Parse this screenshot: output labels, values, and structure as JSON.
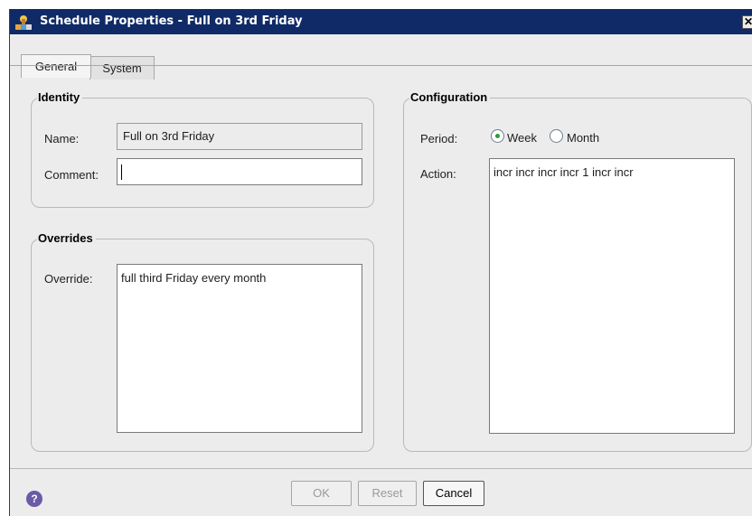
{
  "window": {
    "title": "Schedule Properties - Full on 3rd Friday",
    "close_glyph": "✕",
    "icon": "schedule-app-icon"
  },
  "tabs": [
    {
      "label": "General",
      "selected": true
    },
    {
      "label": "System",
      "selected": false
    }
  ],
  "identity": {
    "title": "Identity",
    "name_label": "Name:",
    "name_value": "Full on 3rd Friday",
    "comment_label": "Comment:",
    "comment_value": ""
  },
  "overrides": {
    "title": "Overrides",
    "override_label": "Override:",
    "override_value": "full third Friday every month"
  },
  "configuration": {
    "title": "Configuration",
    "period_label": "Period:",
    "period_options": [
      {
        "label": "Week",
        "selected": true
      },
      {
        "label": "Month",
        "selected": false
      }
    ],
    "action_label": "Action:",
    "action_value": "incr incr incr incr 1 incr incr"
  },
  "footer": {
    "help_glyph": "?",
    "ok_label": "OK",
    "reset_label": "Reset",
    "cancel_label": "Cancel"
  },
  "colors": {
    "titlebar": "#0f2a66",
    "radio_selected": "#2e9c3a",
    "help_icon": "#6b5aa6"
  }
}
